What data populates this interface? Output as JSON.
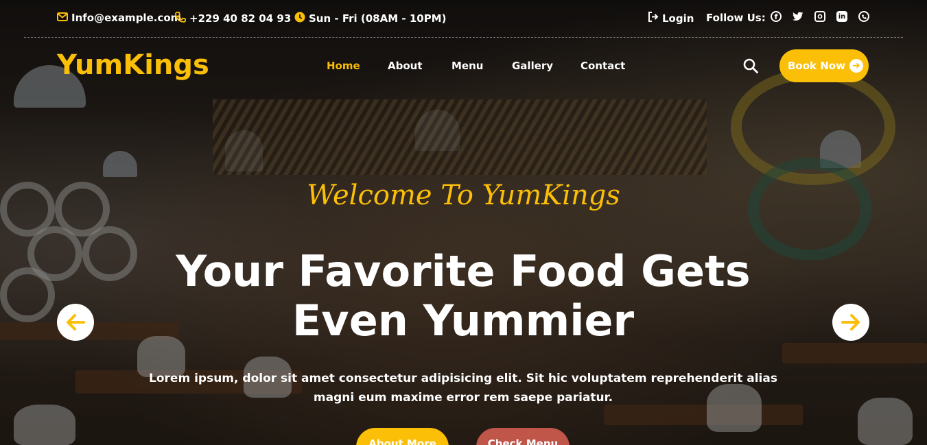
{
  "topbar": {
    "email": "Info@example.com",
    "phone": "+229 40 82 04 93",
    "hours": "Sun - Fri (08AM - 10PM)",
    "login": "Login",
    "follow_label": "Follow Us:",
    "socials": [
      "facebook-icon",
      "twitter-icon",
      "instagram-icon",
      "linkedin-icon",
      "whatsapp-icon"
    ]
  },
  "brand": {
    "logo": "YumKings",
    "accent": "#fbbf07",
    "secondary": "#c0554a"
  },
  "nav": {
    "items": [
      "Home",
      "About",
      "Menu",
      "Gallery",
      "Contact"
    ],
    "active": "Home",
    "book_label": "Book Now"
  },
  "hero": {
    "welcome": "Welcome To YumKings",
    "headline": "Your Favorite Food Gets Even Yummier",
    "lead": "Lorem ipsum, dolor sit amet consectetur adipisicing elit. Sit hic voluptatem reprehenderit alias magni eum maxime error rem saepe pariatur.",
    "cta_primary": "About More",
    "cta_secondary": "Check Menu"
  }
}
